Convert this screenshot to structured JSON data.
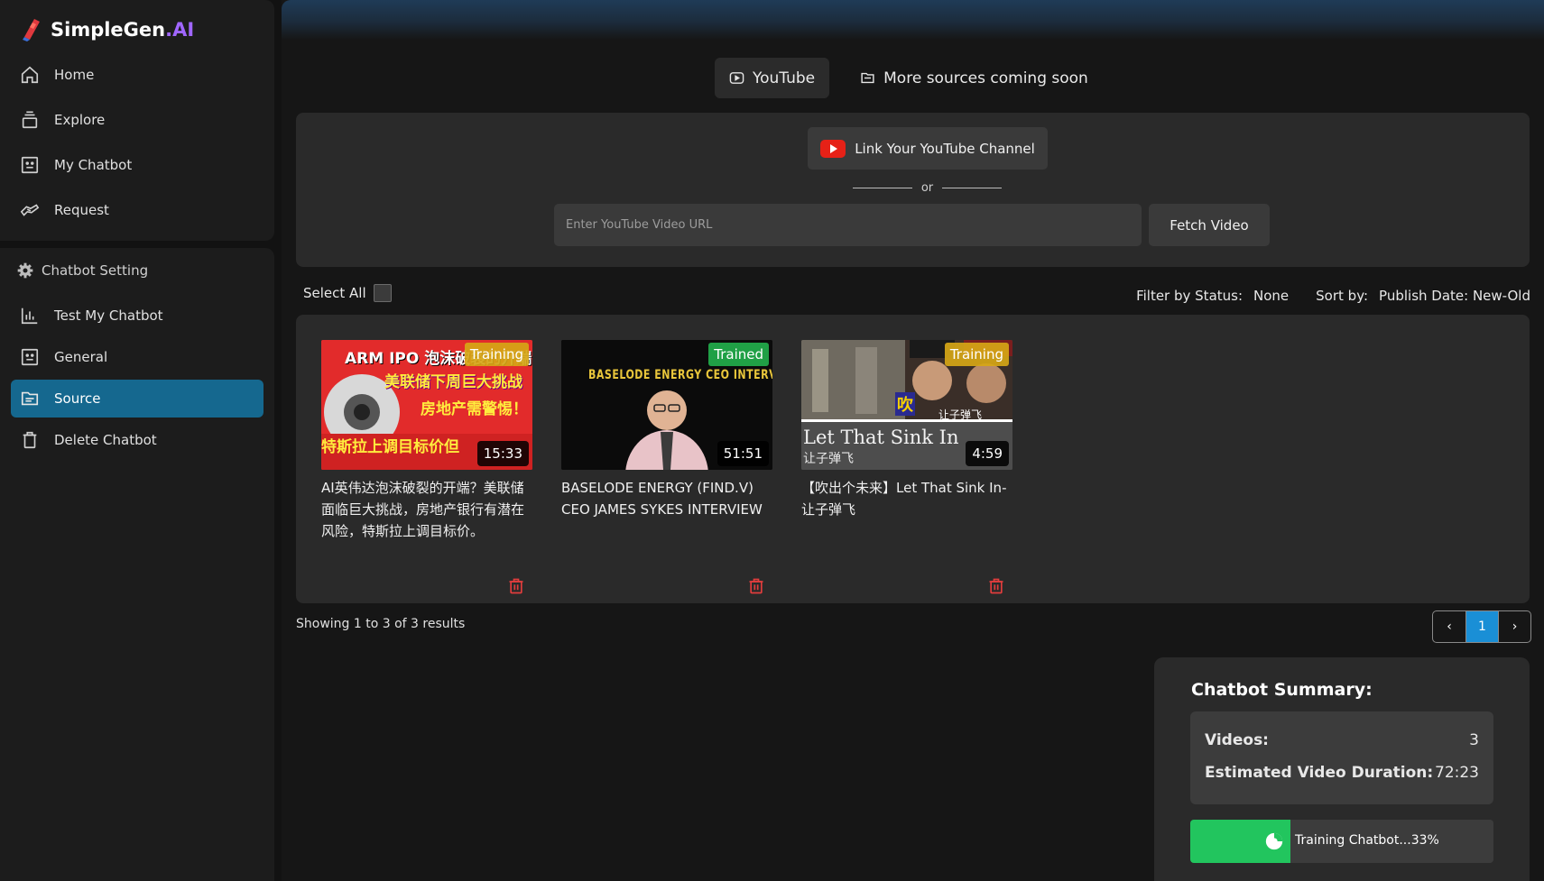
{
  "app": {
    "name": "SimpleGen",
    "name_suffix": ".AI"
  },
  "nav_top": [
    {
      "label": "Home",
      "icon": "home-icon"
    },
    {
      "label": "Explore",
      "icon": "layers-icon"
    },
    {
      "label": "My Chatbot",
      "icon": "bot-icon"
    },
    {
      "label": "Request",
      "icon": "handshake-icon"
    }
  ],
  "settings": {
    "heading": "Chatbot Setting",
    "items": [
      {
        "label": "Test My Chatbot",
        "icon": "chart-icon"
      },
      {
        "label": "General",
        "icon": "bot-icon"
      },
      {
        "label": "Source",
        "icon": "folder-icon",
        "active": true
      },
      {
        "label": "Delete Chatbot",
        "icon": "trash-icon"
      }
    ]
  },
  "tabs": {
    "youtube": "YouTube",
    "more": "More sources coming soon"
  },
  "link_panel": {
    "link_button": "Link Your YouTube Channel",
    "or_text": "or",
    "url_placeholder": "Enter YouTube Video URL",
    "fetch_button": "Fetch Video"
  },
  "toolbar": {
    "select_all": "Select All",
    "filter_label": "Filter by Status:",
    "filter_value": "None",
    "sort_label": "Sort by:",
    "sort_value": "Publish Date: New-Old"
  },
  "videos": [
    {
      "title": "AI英伟达泡沫破裂的开端？美联储面临巨大挑战，房地产银行有潜在风险，特斯拉上调目标价。",
      "status": "Training",
      "duration": "15:33",
      "thumb_text": [
        "ARM IPO 泡沫破裂的开端",
        "美联储下周巨大挑战",
        "房地产需警惕！",
        "特斯拉上调目标价但"
      ]
    },
    {
      "title": "BASELODE ENERGY (FIND.V) CEO JAMES SYKES INTERVIEW",
      "status": "Trained",
      "duration": "51:51",
      "thumb_text": [
        "BASELODE ENERGY CEO INTERVIEWS"
      ]
    },
    {
      "title": "【吹出个未来】Let That Sink In-让子弹飞",
      "status": "Training",
      "duration": "4:59",
      "thumb_text": [
        "Let That Sink In",
        "让子弹飞",
        "吹",
        "让子弹飞"
      ]
    }
  ],
  "pagination": {
    "results": "Showing 1 to 3 of 3 results",
    "current_page": "1",
    "prev": "‹",
    "next": "›"
  },
  "summary": {
    "title": "Chatbot Summary:",
    "videos_label": "Videos:",
    "videos_value": "3",
    "duration_label": "Estimated Video Duration:",
    "duration_value": "72:23",
    "progress_text": "Training Chatbot...33%",
    "progress_percent": 33
  },
  "colors": {
    "accent": "#15688f",
    "page_active": "#1a8fd6",
    "trained": "#20a046",
    "training": "#d6a616",
    "progress": "#22c55e",
    "brand_ai": "#a066ff"
  }
}
